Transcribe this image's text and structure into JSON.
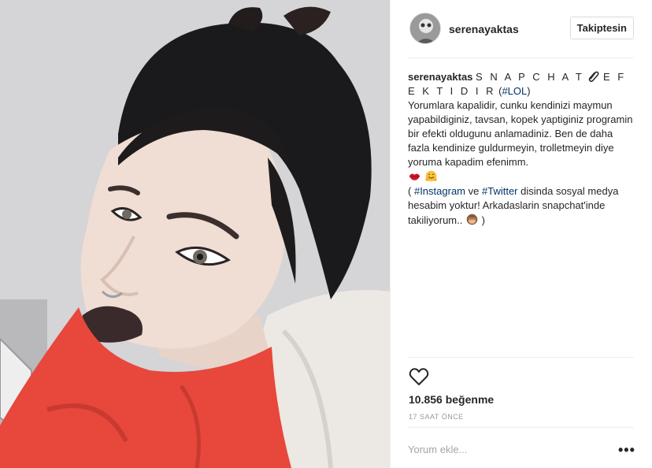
{
  "post": {
    "username": "serenayaktas",
    "follow_label": "Takiptesin",
    "caption": {
      "user": "serenayaktas",
      "title_spaced": "S N A P C H A T",
      "title_spaced_2": "E F E K T I D I R",
      "hashtag_lol": "#LOL",
      "body": "Yorumlara kapalidir, cunku kendinizi maymun yapabildiginiz, tavsan, kopek yaptiginiz programin bir efekti oldugunu anlamadiniz. Ben de daha fazla kendinize guldurmeyin, trolletmeyin diye yoruma kapadim efenimm.",
      "paren_open": "(",
      "hashtag_instagram": "#Instagram",
      "ve": "ve",
      "hashtag_twitter": "#Twitter",
      "tail": "disinda sosyal medya hesabim yoktur! Arkadaslarin snapchat'inde takiliyorum..",
      "paren_close": ")"
    },
    "likes_text": "10.856 beğenme",
    "time_text": "17 SAAT ÖNCE",
    "comment_placeholder": "Yorum ekle...",
    "more_label": "•••"
  },
  "icons": {
    "heart": "heart-outline-icon",
    "paperclip": "paperclip-emoji",
    "lips": "lips-emoji",
    "hug": "hugging-face-emoji",
    "monkey": "see-no-evil-monkey-emoji"
  },
  "colors": {
    "hashtag": "#003569",
    "scarf": "#e8473c",
    "lipstick": "#3a2a2c"
  }
}
